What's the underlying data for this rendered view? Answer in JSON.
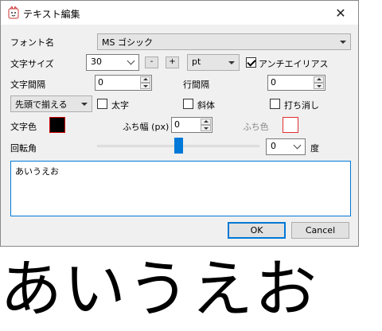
{
  "window": {
    "title": "テキスト編集",
    "close_glyph": "✕"
  },
  "font": {
    "label": "フォント名",
    "value": "MS ゴシック"
  },
  "size": {
    "label": "文字サイズ",
    "value": "30",
    "minus": "-",
    "plus": "+",
    "unit": "pt"
  },
  "antialias": {
    "label": "アンチエイリアス",
    "checked": true
  },
  "char_spacing": {
    "label": "文字間隔",
    "value": "0"
  },
  "line_spacing": {
    "label": "行間隔",
    "value": "0"
  },
  "align": {
    "value": "先頭で揃える"
  },
  "bold": {
    "label": "太字",
    "checked": false
  },
  "italic": {
    "label": "斜体",
    "checked": false
  },
  "strike": {
    "label": "打ち消し",
    "checked": false
  },
  "text_color": {
    "label": "文字色",
    "color": "#000000"
  },
  "outline_width": {
    "label": "ふち幅 (px)",
    "value": "0"
  },
  "outline_color": {
    "label": "ふち色",
    "color": "#ffffff",
    "border": "#e03030"
  },
  "rotation": {
    "label": "回転角",
    "value": "0",
    "unit": "度",
    "slider_fraction": 0.5
  },
  "text": {
    "value": "あいうえお"
  },
  "buttons": {
    "ok": "OK",
    "cancel": "Cancel"
  },
  "preview": {
    "text": "あいうえお"
  },
  "colors": {
    "accent": "#0078d7"
  }
}
